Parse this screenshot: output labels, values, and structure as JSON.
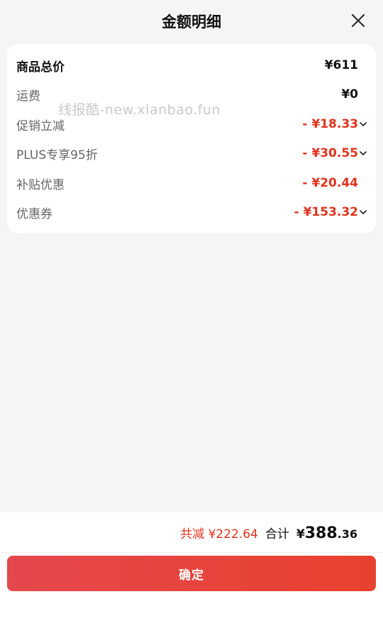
{
  "header": {
    "title": "金额明细",
    "close_icon": "close-icon"
  },
  "watermark": "线报酷-new.xianbao.fun",
  "breakdown": [
    {
      "label": "商品总价",
      "value": "¥611",
      "strong": true,
      "discount": false,
      "expandable": false
    },
    {
      "label": "运费",
      "value": "¥0",
      "strong": false,
      "discount": false,
      "expandable": false
    },
    {
      "label": "促销立减",
      "value": "- ¥18.33",
      "strong": false,
      "discount": true,
      "expandable": true
    },
    {
      "label": "PLUS专享95折",
      "value": "- ¥30.55",
      "strong": false,
      "discount": true,
      "expandable": true
    },
    {
      "label": "补贴优惠",
      "value": "- ¥20.44",
      "strong": false,
      "discount": true,
      "expandable": false
    },
    {
      "label": "优惠券",
      "value": "- ¥153.32",
      "strong": false,
      "discount": true,
      "expandable": true
    }
  ],
  "footer": {
    "total_discount": "共减 ¥222.64",
    "total_label": "合计",
    "currency": "¥",
    "total_integer": "388",
    "total_decimal": ".36",
    "confirm_label": "确定"
  },
  "colors": {
    "discount": "#e2321e",
    "button_start": "#e5484d",
    "button_end": "#e8412e",
    "background": "#f5f5f5"
  }
}
